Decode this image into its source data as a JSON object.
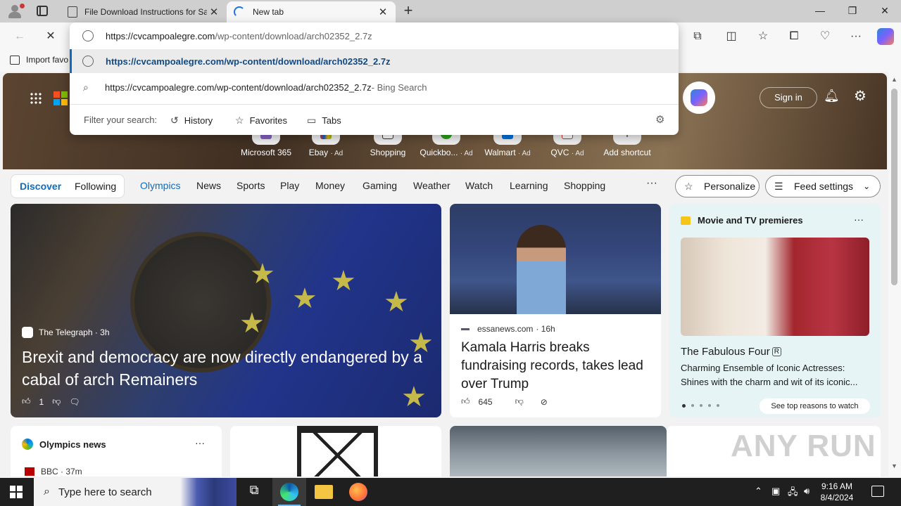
{
  "browser": {
    "tabs": [
      {
        "title": "File Download Instructions for Sa",
        "active": false
      },
      {
        "title": "New tab",
        "active": true
      }
    ],
    "window_controls": {
      "minimize": "—",
      "maximize": "❐",
      "close": "✕"
    },
    "bookmarks": {
      "import_label": "Import favo"
    }
  },
  "omnibox": {
    "input_host": "https://cvcampoalegre.com",
    "input_path": "/wp-content/download/arch02352_2.7z",
    "suggestion_url": "https://cvcampoalegre.com/wp-content/download/arch02352_2.7z",
    "bing_query": "https://cvcampoalegre.com/wp-content/download/arch02352_2.7z",
    "bing_suffix": " - Bing Search",
    "filter_label": "Filter your search:",
    "filters": [
      "History",
      "Favorites",
      "Tabs"
    ]
  },
  "newtab": {
    "signin": "Sign in",
    "shortcuts": [
      {
        "label": "Microsoft 365",
        "ad": ""
      },
      {
        "label": "Ebay",
        "ad": "· Ad"
      },
      {
        "label": "Shopping",
        "ad": ""
      },
      {
        "label": "Quickbo...",
        "ad": "· Ad"
      },
      {
        "label": "Walmart",
        "ad": "· Ad"
      },
      {
        "label": "QVC",
        "ad": "· Ad"
      },
      {
        "label": "Add shortcut",
        "ad": ""
      }
    ],
    "feed_tabs": {
      "discover": "Discover",
      "following": "Following"
    },
    "nav_items": [
      "Olympics",
      "News",
      "Sports",
      "Play",
      "Money",
      "Gaming",
      "Weather",
      "Watch",
      "Learning",
      "Shopping"
    ],
    "more": "···",
    "personalize": "Personalize",
    "feed_settings": "Feed settings"
  },
  "cards": {
    "big": {
      "source": "The Telegraph · 3h",
      "title": "Brexit and democracy are now directly endangered by a cabal of arch Remainers",
      "likes": "1"
    },
    "mid": {
      "source": "essanews.com",
      "time": "· 16h",
      "title": "Kamala Harris breaks fundraising records, takes lead over Trump",
      "likes": "645"
    },
    "right": {
      "heading": "Movie and TV premieres",
      "title": "The Fabulous Four",
      "rating": "R",
      "desc": "Charming Ensemble of Iconic Actresses: Shines with the charm and wit of its iconic...",
      "cta": "See top reasons to watch"
    },
    "olympics": {
      "heading": "Olympics news",
      "source": "BBC · 37m"
    }
  },
  "watermark": "ANY RUN",
  "taskbar": {
    "search_placeholder": "Type here to search",
    "time": "9:16 AM",
    "date": "8/4/2024"
  }
}
